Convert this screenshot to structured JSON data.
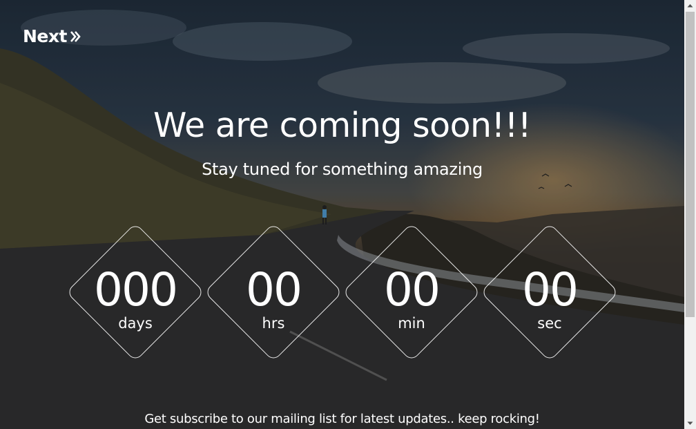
{
  "brand": {
    "logo_text": "Next",
    "logo_icon": "double-chevron-right-icon"
  },
  "hero": {
    "title": "We are coming soon!!!",
    "subtitle": "Stay tuned for something amazing"
  },
  "countdown": [
    {
      "value": "000",
      "unit": "days"
    },
    {
      "value": "00",
      "unit": "hrs"
    },
    {
      "value": "00",
      "unit": "min"
    },
    {
      "value": "00",
      "unit": "sec"
    }
  ],
  "footer": {
    "message": "Get subscribe to our mailing list for latest updates.. keep rocking!"
  },
  "colors": {
    "text": "#ffffff",
    "diamond_border": "#ffffff",
    "scrollbar_track": "#f1f1f1",
    "scrollbar_thumb": "#c1c1c1"
  }
}
